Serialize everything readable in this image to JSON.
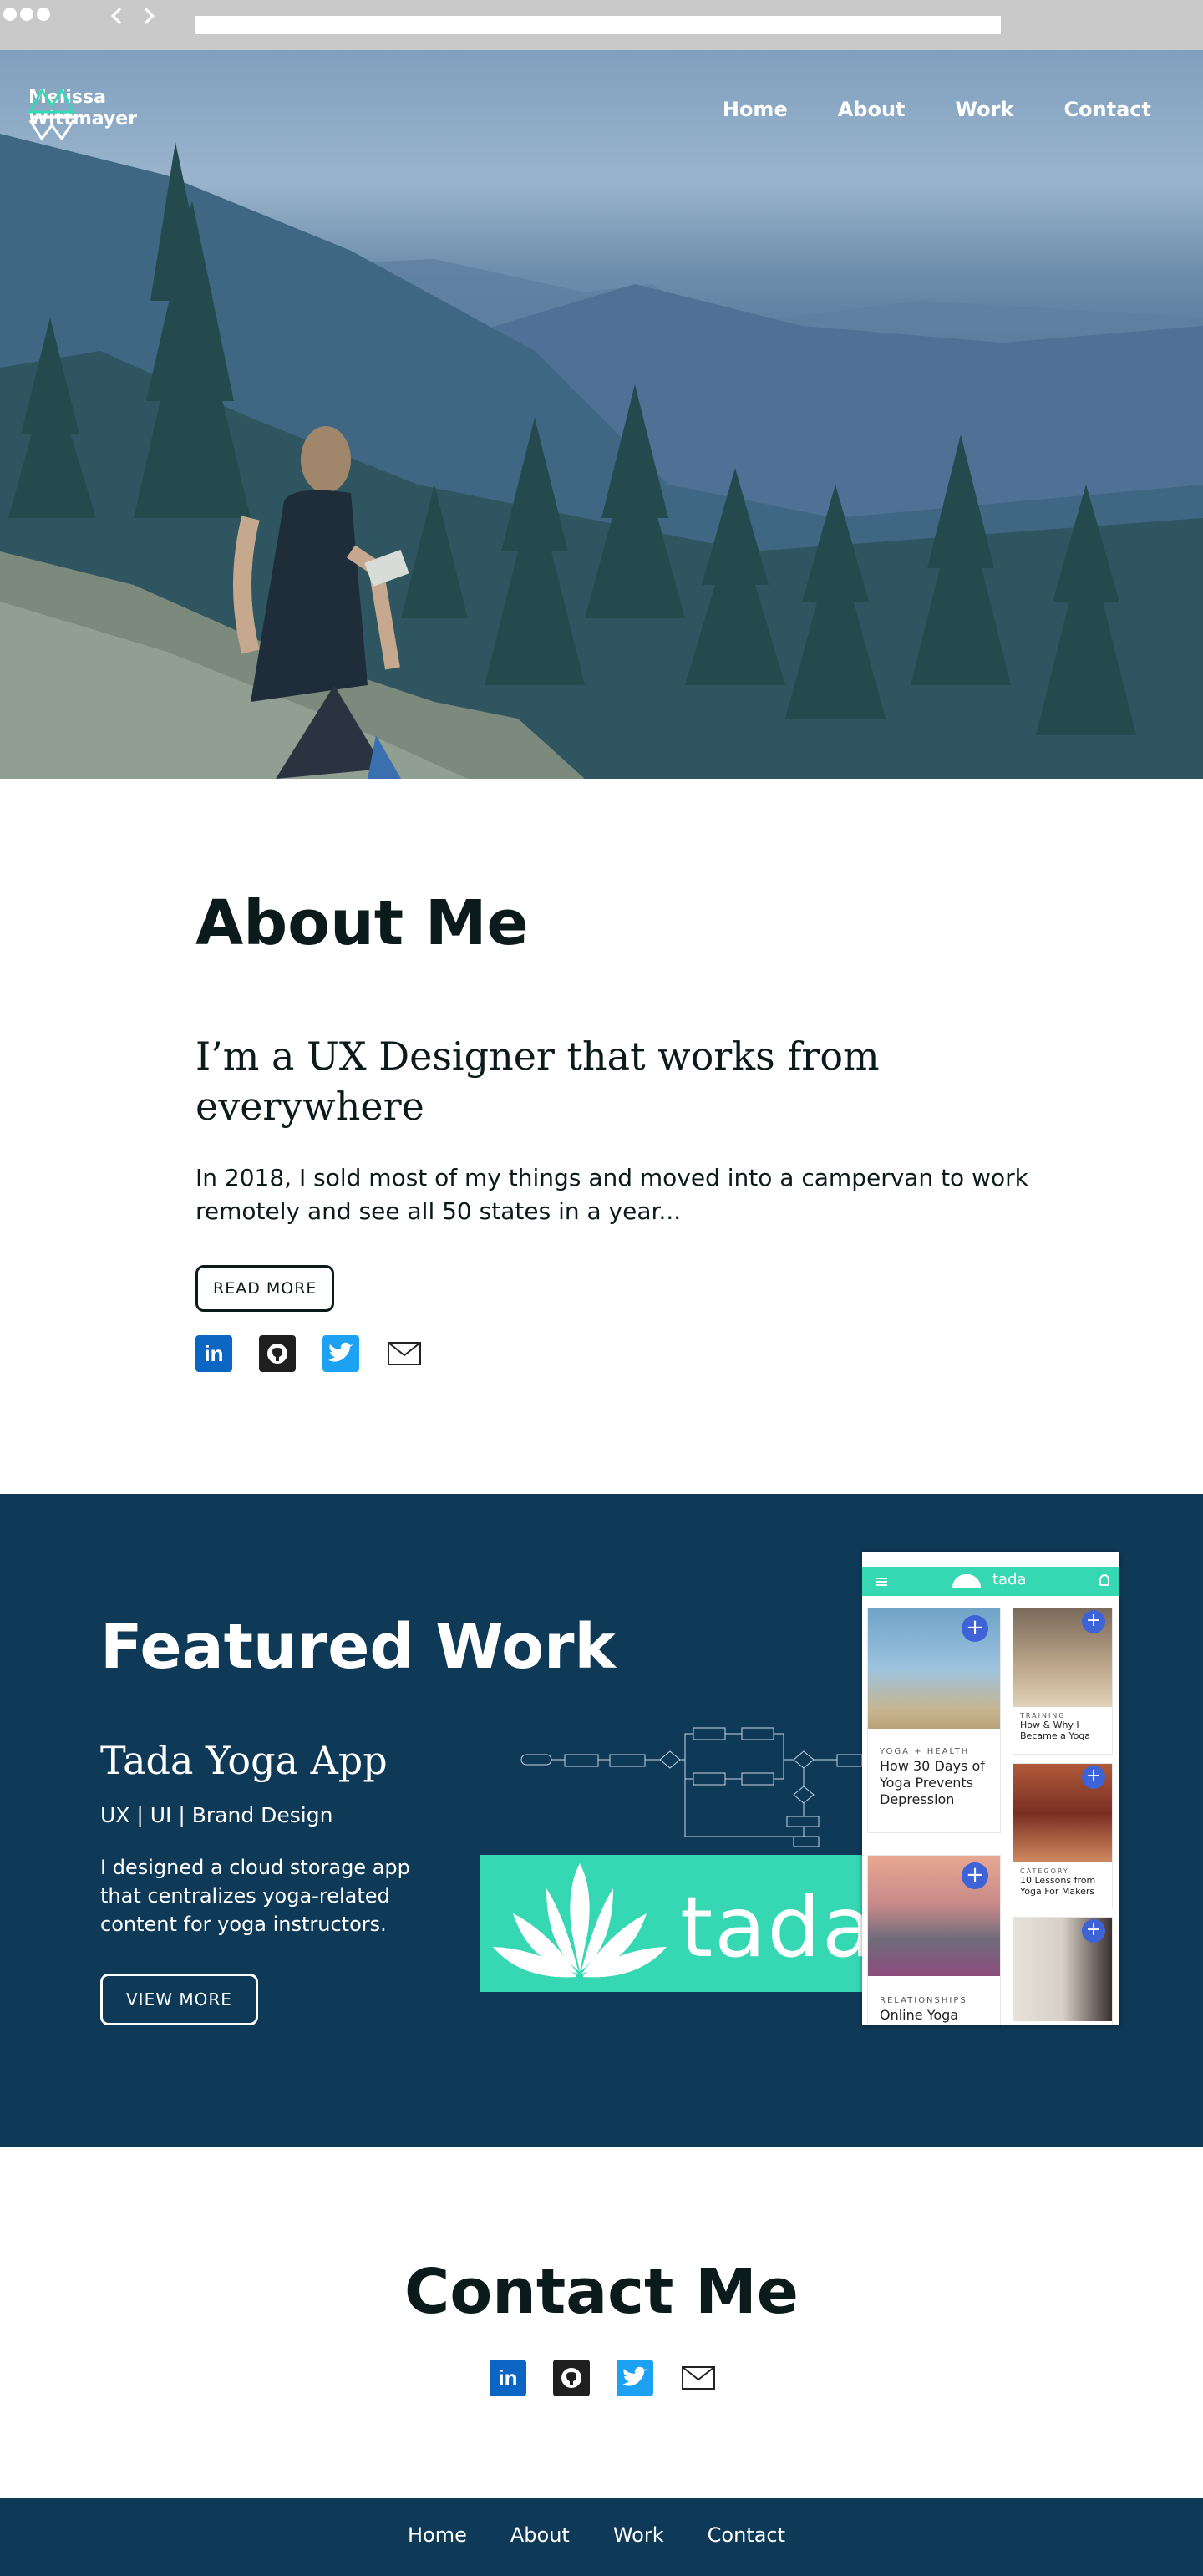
{
  "browser": {
    "url": ""
  },
  "header": {
    "brand_line1": "Melissa",
    "brand_line2": "Wittmayer",
    "nav": [
      "Home",
      "About",
      "Work",
      "Contact"
    ]
  },
  "about": {
    "title": "About Me",
    "headline": "I’m a UX Designer that works from everywhere",
    "body": "In 2018, I sold most of my things and moved into a campervan to work remotely and see all 50 states in a year...",
    "button": "READ MORE",
    "social_icons": [
      "linkedin-icon",
      "github-icon",
      "twitter-icon",
      "mail-icon"
    ]
  },
  "featured": {
    "title": "Featured Work",
    "project_title": "Tada Yoga App",
    "project_tags": "UX | UI | Brand Design",
    "project_desc": "I designed a cloud storage app that centralizes yoga-related content for yoga instructors.",
    "button": "VIEW MORE",
    "banner_word": "tada",
    "phone": {
      "app_name": "tada",
      "cards": [
        {
          "category": "YOGA + HEALTH",
          "title": "How 30 Days of Yoga Prevents Depression"
        },
        {
          "category": "RELATIONSHIPS",
          "title": "Online Yoga"
        },
        {
          "category": "TRAINING",
          "title": "How & Why I Became a Yoga"
        },
        {
          "category": "CATEGORY",
          "title": "10 Lessons from Yoga For Makers"
        }
      ]
    }
  },
  "contact": {
    "title": "Contact Me"
  },
  "footer": {
    "nav": [
      "Home",
      "About",
      "Work",
      "Contact"
    ]
  },
  "colors": {
    "navy": "#0f3a57",
    "teal": "#36d8b4",
    "accent_blue": "#3d63d6"
  }
}
